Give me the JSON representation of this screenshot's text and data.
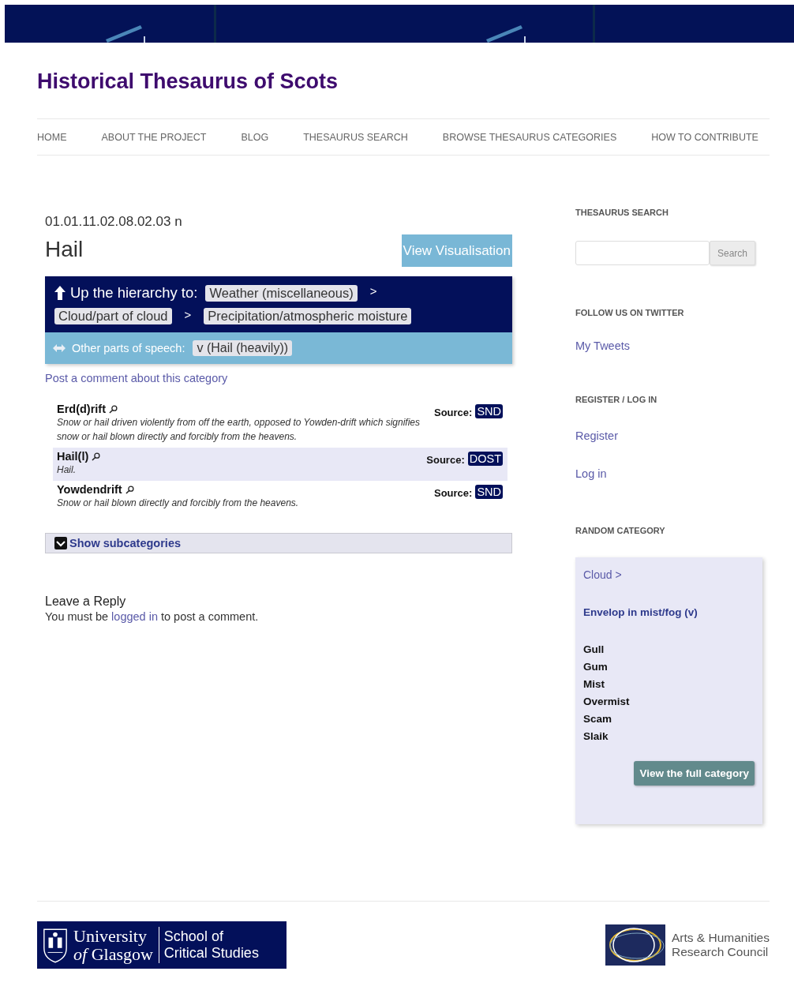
{
  "site_title": "Historical Thesaurus of Scots",
  "nav": [
    {
      "label": "HOME"
    },
    {
      "label": "ABOUT THE PROJECT"
    },
    {
      "label": "BLOG"
    },
    {
      "label": "THESAURUS SEARCH"
    },
    {
      "label": "BROWSE THESAURUS CATEGORIES"
    },
    {
      "label": "HOW TO CONTRIBUTE"
    }
  ],
  "category": {
    "code": "01.01.11.02.08.02.03 n",
    "title": "Hail",
    "visualise_button": "View Visualisation",
    "hierarchy_label": "Up the hierarchy to:",
    "hierarchy": [
      {
        "label": "Weather (miscellaneous)",
        "separator": ">"
      },
      {
        "label": "Cloud/part of cloud",
        "separator": ">"
      },
      {
        "label": "Precipitation/atmospheric moisture"
      }
    ],
    "other_pos_label": "Other parts of speech:",
    "other_pos": [
      "v (Hail (heavily))"
    ],
    "comment_link": "Post a comment about this category",
    "words": [
      {
        "word": "Erd(d)rift",
        "definition": "Snow or hail driven violently from off the earth, opposed to Yowden-drift which signifies snow or hail blown directly and forcibly from the heavens.",
        "source_label": "Source:",
        "source": "SND"
      },
      {
        "word": "Hail(l)",
        "definition": "Hail.",
        "source_label": "Source:",
        "source": "DOST"
      },
      {
        "word": "Yowdendrift",
        "definition": "Snow or hail blown directly and forcibly from the heavens.",
        "source_label": "Source:",
        "source": "SND"
      }
    ],
    "subcategories_toggle": {
      "label": "Show subcategories",
      "expanded": false
    }
  },
  "reply": {
    "heading": "Leave a Reply",
    "text_before": "You must be",
    "link": "logged in",
    "text_after": "to post a comment."
  },
  "sidebar": {
    "search": {
      "heading": "THESAURUS SEARCH",
      "button": "Search"
    },
    "twitter": {
      "heading": "FOLLOW US ON TWITTER",
      "link": "My Tweets"
    },
    "account": {
      "heading": "REGISTER / LOG IN",
      "links": [
        "Register",
        "Log in"
      ]
    },
    "random": {
      "heading": "RANDOM CATEGORY",
      "parent": "Cloud >",
      "category": "Envelop in mist/fog (v)",
      "words": [
        "Gull",
        "Gum",
        "Mist",
        "Overmist",
        "Scam",
        "Slaik"
      ],
      "button": "View the full category"
    }
  },
  "footer": {
    "glasgow_name": [
      "University",
      "*of* Glasgow"
    ],
    "glasgow_school": [
      "School of",
      "Critical Studies"
    ],
    "ahrc": [
      "Arts & Humanities",
      "Research Council"
    ]
  }
}
